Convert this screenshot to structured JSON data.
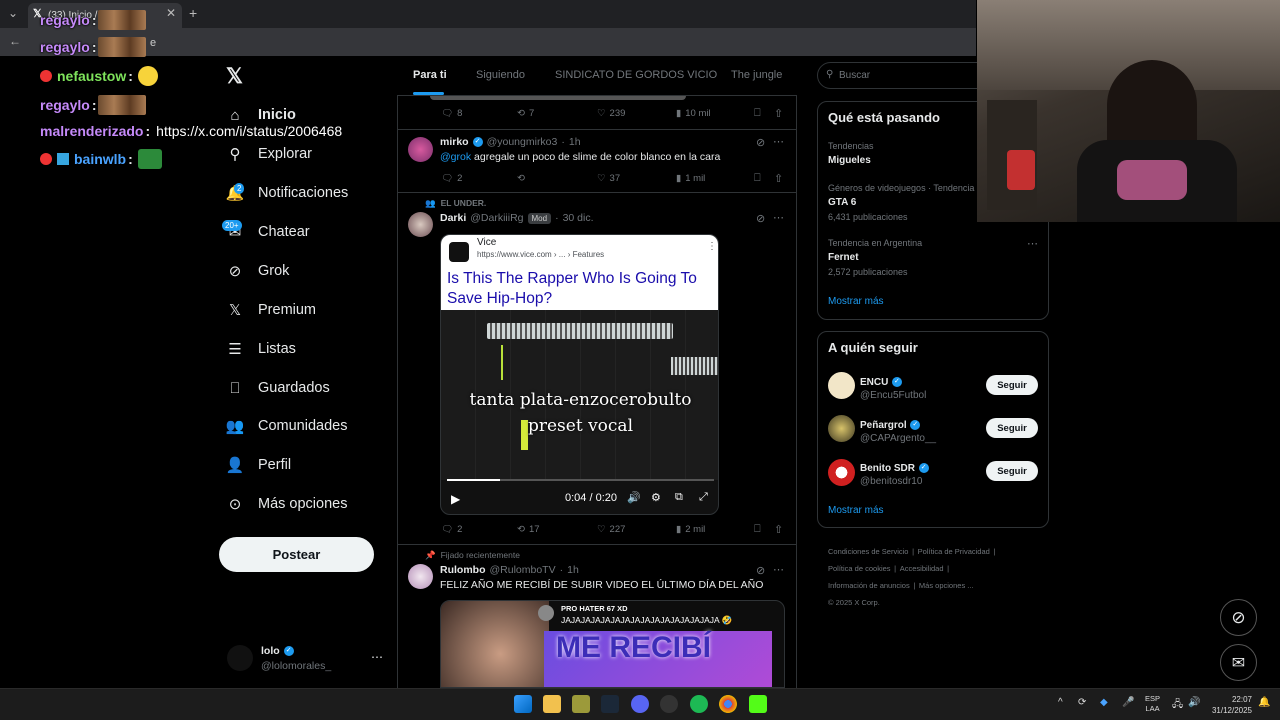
{
  "browser": {
    "tab_title": "(33) Inicio / X",
    "url_fragment": "e"
  },
  "chat": [
    {
      "user": "regaylo",
      "sep": ":",
      "text": ""
    },
    {
      "user": "regaylo",
      "sep": ":",
      "text": ""
    },
    {
      "user": "nefaustow",
      "sep": ":",
      "text": ""
    },
    {
      "user": "regaylo",
      "sep": ":",
      "text": ""
    },
    {
      "user": "malrenderizado",
      "sep": ":",
      "text": "https://x.com/i/status/2006468"
    },
    {
      "user": "bainwlb",
      "sep": ":",
      "text": ""
    }
  ],
  "nav": {
    "items": [
      {
        "label": "Inicio"
      },
      {
        "label": "Explorar"
      },
      {
        "label": "Notificaciones",
        "badge": "2"
      },
      {
        "label": "Chatear",
        "badge": "20+"
      },
      {
        "label": "Grok"
      },
      {
        "label": "Premium"
      },
      {
        "label": "Listas"
      },
      {
        "label": "Guardados"
      },
      {
        "label": "Comunidades"
      },
      {
        "label": "Perfil"
      },
      {
        "label": "Más opciones"
      }
    ],
    "post_label": "Postear",
    "account": {
      "name": "lolo",
      "handle": "@lolomorales_"
    }
  },
  "feed": {
    "tabs": [
      "Para ti",
      "Siguiendo",
      "SINDICATO DE GORDOS VICIO",
      "The jungle"
    ],
    "top_actions": {
      "replies": "8",
      "reposts": "7",
      "likes": "239",
      "views": "10 mil"
    },
    "tweet1": {
      "name": "mirko",
      "handle": "@youngmirko3",
      "time": "1h",
      "mention": "@grok",
      "text": "agregale un poco de slime de color blanco en la cara",
      "replies": "2",
      "reposts": "",
      "likes": "37",
      "views": "1 mil"
    },
    "tweet2": {
      "context": "EL UNDER.",
      "name": "Darki",
      "handle": "@DarkiiiRg",
      "tag": "Mod",
      "time": "30 dic.",
      "video": {
        "site": "Vice",
        "url": "https://www.vice.com › ... › Features",
        "headline": "Is This The Rapper Who Is Going To Save Hip-Hop?",
        "overlay_line1": "tanta plata-enzocerobulto",
        "overlay_line2": "preset vocal",
        "time": "0:04 / 0:20"
      },
      "replies": "2",
      "reposts": "17",
      "likes": "227",
      "views": "2 mil"
    },
    "tweet3": {
      "context": "Fijado recientemente",
      "name": "Rulombo",
      "handle": "@RulomboTV",
      "time": "1h",
      "text": "FELIZ AÑO ME RECIBÍ DE SUBIR VIDEO EL ÚLTIMO DÍA DEL AÑO",
      "media_user": "PRO HATER 67 XD",
      "media_text": "JAJAJAJAJAJAJAJAJAJAJAJAJAJAJAJA 🤣",
      "media_banner": "ME RECIBÍ"
    }
  },
  "sidebar": {
    "search_placeholder": "Buscar",
    "trends_title": "Qué está pasando",
    "trends": [
      {
        "context": "Tendencias",
        "name": "Migueles",
        "count": ""
      },
      {
        "context": "Géneros de videojuegos · Tendencia",
        "name": "GTA 6",
        "count": "6,431 publicaciones"
      },
      {
        "context": "Tendencia en Argentina",
        "name": "Fernet",
        "count": "2,572 publicaciones"
      }
    ],
    "show_more": "Mostrar más",
    "follow_title": "A quién seguir",
    "follow": [
      {
        "name": "ENCU",
        "handle": "@Encu5Futbol"
      },
      {
        "name": "Peñargrol",
        "handle": "@CAPArgento__"
      },
      {
        "name": "Benito SDR",
        "handle": "@benitosdr10"
      }
    ],
    "follow_label": "Seguir",
    "footer": [
      "Condiciones de Servicio",
      "Política de Privacidad",
      "Política de cookies",
      "Accesibilidad",
      "Información de anuncios",
      "Más opciones ...",
      "© 2025 X Corp."
    ]
  },
  "taskbar": {
    "lang": "ESP",
    "lang2": "LAA",
    "time": "22:07",
    "date": "31/12/2025"
  },
  "colors": {
    "accent": "#1d9bf0",
    "background": "#000000",
    "border": "#2f3336"
  }
}
